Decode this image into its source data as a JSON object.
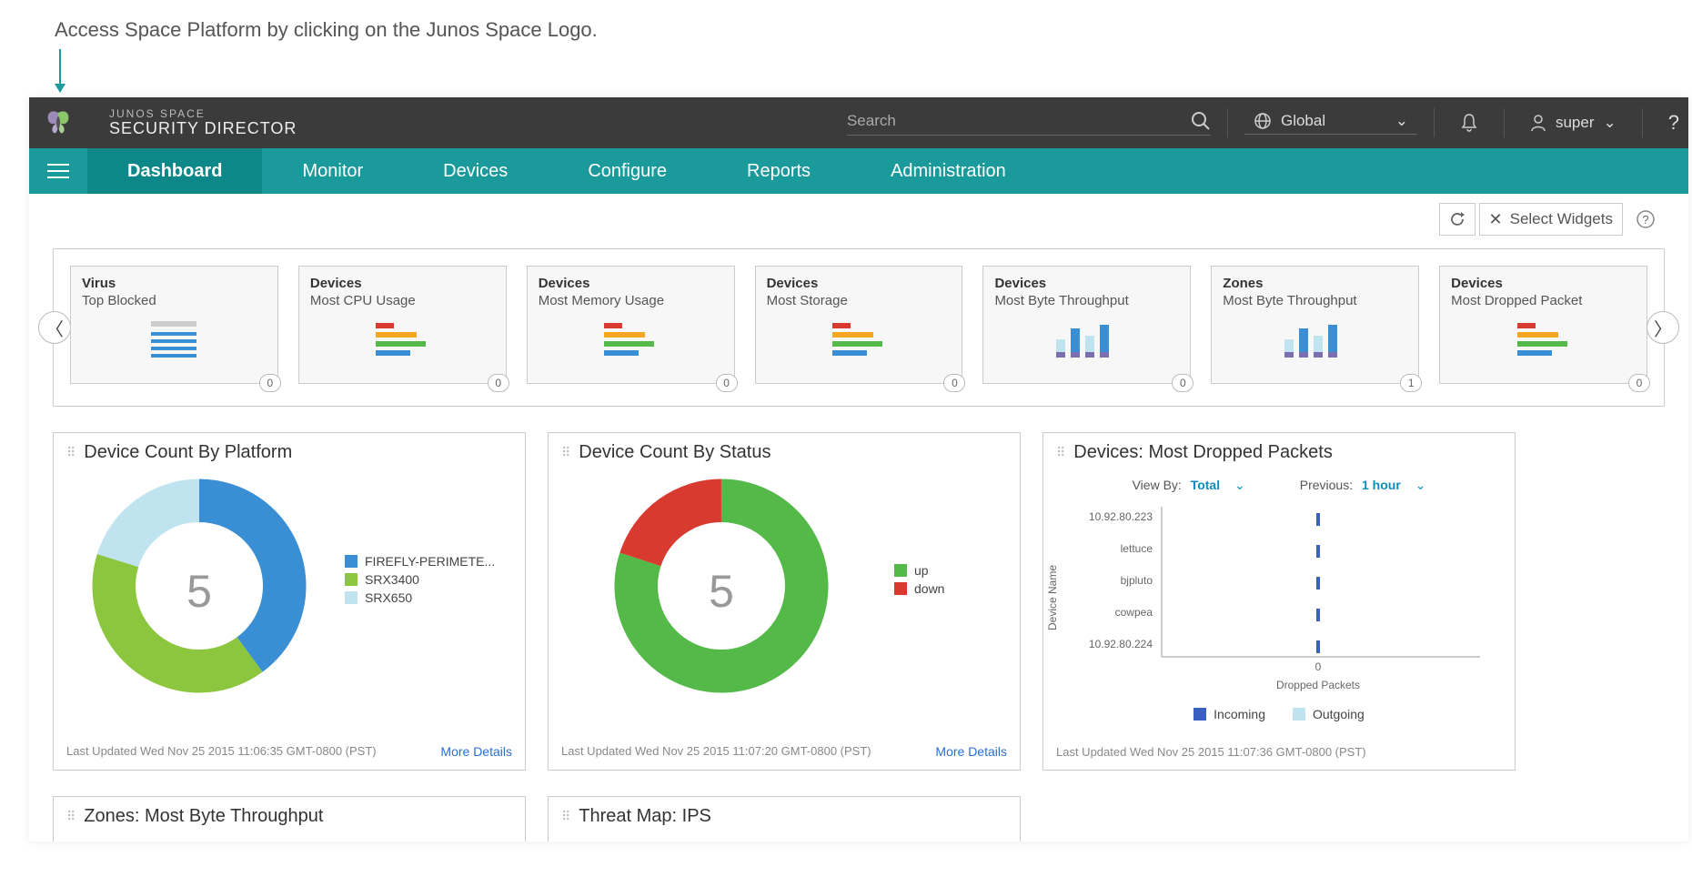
{
  "annotation": "Access Space Platform by clicking on the Junos Space Logo.",
  "header": {
    "brand_top": "JUNOS SPACE",
    "brand_bottom": "SECURITY DIRECTOR",
    "search_placeholder": "Search",
    "scope": "Global",
    "user": "super",
    "help": "?"
  },
  "nav": {
    "tabs": [
      "Dashboard",
      "Monitor",
      "Devices",
      "Configure",
      "Reports",
      "Administration"
    ],
    "active": "Dashboard"
  },
  "toolbar": {
    "select_widgets": "Select Widgets"
  },
  "carousel": [
    {
      "category": "Virus",
      "subtitle": "Top Blocked",
      "thumb": "list",
      "count": 0
    },
    {
      "category": "Devices",
      "subtitle": "Most CPU Usage",
      "thumb": "bars",
      "count": 0
    },
    {
      "category": "Devices",
      "subtitle": "Most Memory Usage",
      "thumb": "bars",
      "count": 0
    },
    {
      "category": "Devices",
      "subtitle": "Most Storage",
      "thumb": "bars",
      "count": 0
    },
    {
      "category": "Devices",
      "subtitle": "Most Byte Throughput",
      "thumb": "cols",
      "count": 0
    },
    {
      "category": "Zones",
      "subtitle": "Most Byte Throughput",
      "thumb": "cols",
      "count": 1
    },
    {
      "category": "Devices",
      "subtitle": "Most Dropped Packet",
      "thumb": "bars",
      "count": 0
    }
  ],
  "panels": {
    "p1": {
      "title": "Device Count By Platform",
      "last_updated": "Last Updated Wed Nov 25 2015 11:06:35 GMT-0800 (PST)",
      "more": "More Details",
      "center": "5",
      "legend": [
        "FIREFLY-PERIMETE...",
        "SRX3400",
        "SRX650"
      ]
    },
    "p2": {
      "title": "Device Count By Status",
      "last_updated": "Last Updated Wed Nov 25 2015 11:07:20 GMT-0800 (PST)",
      "more": "More Details",
      "center": "5",
      "legend": [
        "up",
        "down"
      ]
    },
    "p3": {
      "title": "Devices: Most Dropped Packets",
      "view_by_label": "View By:",
      "view_by_value": "Total",
      "previous_label": "Previous:",
      "previous_value": "1 hour",
      "y_axis": "Device Name",
      "x_axis": "Dropped Packets",
      "x_tick": "0",
      "devices": [
        "10.92.80.223",
        "lettuce",
        "bjpluto",
        "cowpea",
        "10.92.80.224"
      ],
      "legend": [
        "Incoming",
        "Outgoing"
      ],
      "last_updated": "Last Updated Wed Nov 25 2015 11:07:36 GMT-0800 (PST)"
    },
    "p4": {
      "title": "Zones: Most Byte Throughput"
    },
    "p5": {
      "title": "Threat Map: IPS"
    }
  },
  "chart_data": [
    {
      "type": "pie",
      "title": "Device Count By Platform",
      "series": [
        {
          "name": "FIREFLY-PERIMETE...",
          "value": 2,
          "color": "#3a8fd4"
        },
        {
          "name": "SRX3400",
          "value": 2,
          "color": "#8cc63f"
        },
        {
          "name": "SRX650",
          "value": 1,
          "color": "#bfe4ef"
        }
      ],
      "total": 5
    },
    {
      "type": "pie",
      "title": "Device Count By Status",
      "series": [
        {
          "name": "up",
          "value": 4,
          "color": "#54b948"
        },
        {
          "name": "down",
          "value": 1,
          "color": "#d83a2f"
        }
      ],
      "total": 5
    },
    {
      "type": "bar",
      "orientation": "horizontal",
      "title": "Devices: Most Dropped Packets",
      "categories": [
        "10.92.80.223",
        "lettuce",
        "bjpluto",
        "cowpea",
        "10.92.80.224"
      ],
      "series": [
        {
          "name": "Incoming",
          "values": [
            0,
            0,
            0,
            0,
            0
          ],
          "color": "#3a5fbf"
        },
        {
          "name": "Outgoing",
          "values": [
            0,
            0,
            0,
            0,
            0
          ],
          "color": "#bfe4ef"
        }
      ],
      "xlabel": "Dropped Packets",
      "ylabel": "Device Name",
      "xlim": [
        0,
        1
      ]
    }
  ]
}
